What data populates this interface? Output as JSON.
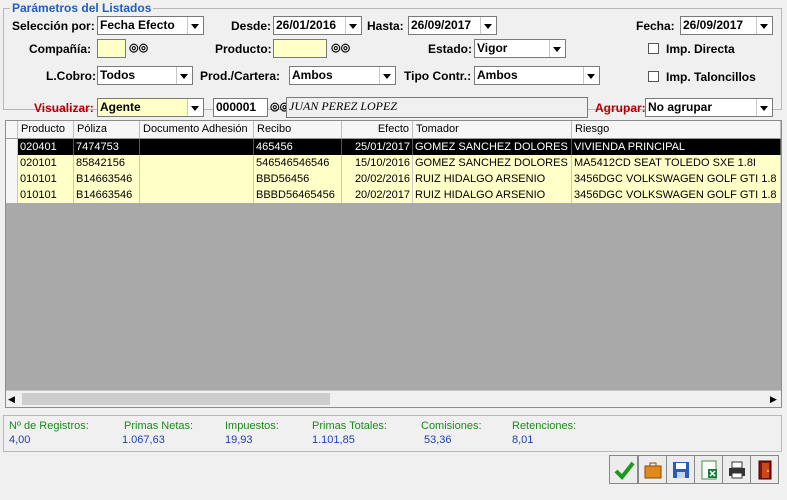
{
  "group_title": "Parámetros del Listados",
  "filters": {
    "seleccion_label": "Selección por:",
    "seleccion_value": "Fecha Efecto",
    "desde_label": "Desde:",
    "desde_value": "26/01/2016",
    "hasta_label": "Hasta:",
    "hasta_value": "26/09/2017",
    "fecha_label": "Fecha:",
    "fecha_value": "26/09/2017",
    "compania_label": "Compañía:",
    "compania_value": "",
    "producto_label": "Producto:",
    "producto_value": "",
    "estado_label": "Estado:",
    "estado_value": "Vigor",
    "imp_directa_label": "Imp. Directa",
    "imp_directa_checked": false,
    "lcobro_label": "L.Cobro:",
    "lcobro_value": "Todos",
    "prodcartera_label": "Prod./Cartera:",
    "prodcartera_value": "Ambos",
    "tipocontr_label": "Tipo Contr.:",
    "tipocontr_value": "Ambos",
    "imp_taloncillos_label": "Imp. Taloncillos",
    "imp_taloncillos_checked": false,
    "visualizar_label": "Visualizar:",
    "visualizar_value": "Agente",
    "agente_code": "000001",
    "agente_name": "JUAN PEREZ LOPEZ",
    "agrupar_label": "Agrupar:",
    "agrupar_value": "No agrupar"
  },
  "table": {
    "columns": [
      "Producto",
      "Póliza",
      "Documento Adhesión",
      "Recibo",
      "Efecto",
      "Tomador",
      "Riesgo"
    ],
    "rows": [
      {
        "producto": "020401",
        "poliza": "7474753",
        "documento": "",
        "recibo": "465456",
        "efecto": "25/01/2017",
        "tomador": "GOMEZ SANCHEZ DOLORES",
        "riesgo": "VIVIENDA PRINCIPAL",
        "selected": true
      },
      {
        "producto": "020101",
        "poliza": "85842156",
        "documento": "",
        "recibo": "546546546546",
        "efecto": "15/10/2016",
        "tomador": "GOMEZ SANCHEZ DOLORES",
        "riesgo": "MA5412CD SEAT TOLEDO SXE 1.8I",
        "selected": false
      },
      {
        "producto": "010101",
        "poliza": "B14663546",
        "documento": "",
        "recibo": "BBD56456",
        "efecto": "20/02/2016",
        "tomador": "RUIZ HIDALGO ARSENIO",
        "riesgo": "3456DGC VOLKSWAGEN GOLF GTI 1.8",
        "selected": false
      },
      {
        "producto": "010101",
        "poliza": "B14663546",
        "documento": "",
        "recibo": "BBBD56465456",
        "efecto": "20/02/2017",
        "tomador": "RUIZ HIDALGO ARSENIO",
        "riesgo": "3456DGC VOLKSWAGEN GOLF GTI 1.8",
        "selected": false
      }
    ]
  },
  "summary": {
    "registros_label": "Nº de Registros:",
    "registros_value": "4,00",
    "primas_netas_label": "Primas Netas:",
    "primas_netas_value": "1.067,63",
    "impuestos_label": "Impuestos:",
    "impuestos_value": "19,93",
    "primas_totales_label": "Primas Totales:",
    "primas_totales_value": "1.101,85",
    "comisiones_label": "Comisiones:",
    "comisiones_value": "53,36",
    "retenciones_label": "Retenciones:",
    "retenciones_value": "8,01"
  },
  "toolbar": [
    "accept-icon",
    "briefcase-icon",
    "save-icon",
    "excel-export-icon",
    "print-icon",
    "exit-door-icon"
  ],
  "colors": {
    "input_yellow": "#ffffc8",
    "selected_row": "#000000",
    "title_blue": "#1f5fbf",
    "summary_label_green": "#1a8a1a",
    "summary_value_blue": "#1c3fb8",
    "visualizar_red": "#b00000"
  }
}
